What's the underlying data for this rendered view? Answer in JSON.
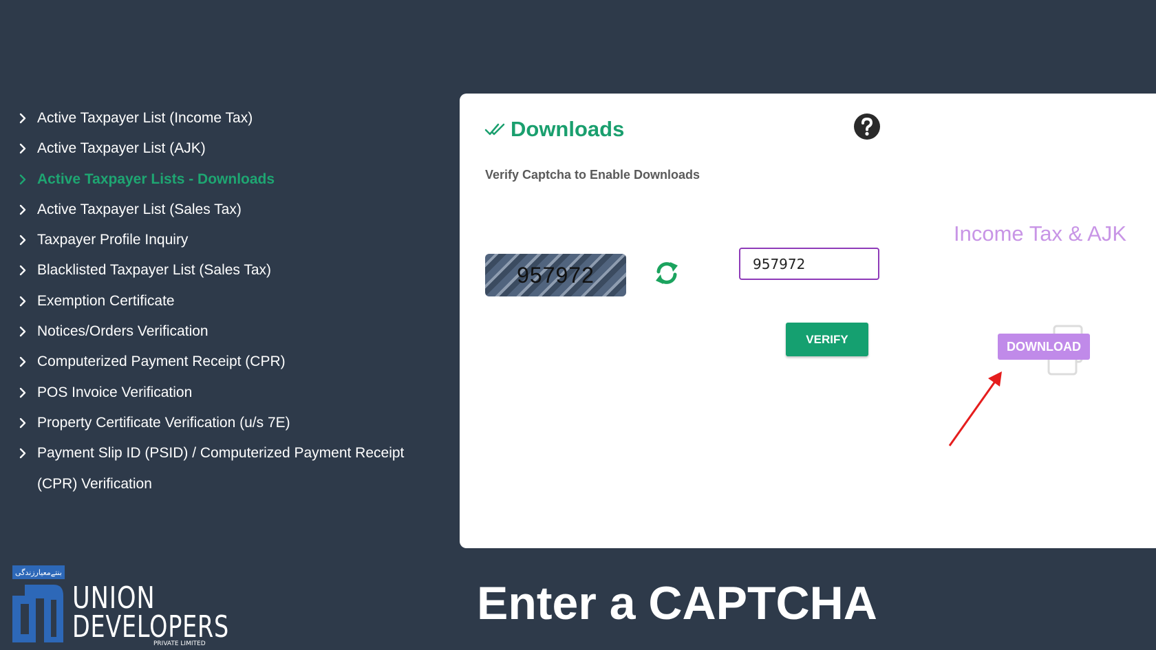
{
  "sidebar": {
    "items": [
      {
        "label": "Active Taxpayer List (Income Tax)",
        "active": false
      },
      {
        "label": "Active Taxpayer List (AJK)",
        "active": false
      },
      {
        "label": "Active Taxpayer Lists - Downloads",
        "active": true
      },
      {
        "label": "Active Taxpayer List (Sales Tax)",
        "active": false
      },
      {
        "label": "Taxpayer Profile Inquiry",
        "active": false
      },
      {
        "label": "Blacklisted Taxpayer List (Sales Tax)",
        "active": false
      },
      {
        "label": "Exemption Certificate",
        "active": false
      },
      {
        "label": "Notices/Orders Verification",
        "active": false
      },
      {
        "label": "Computerized Payment Receipt (CPR)",
        "active": false
      },
      {
        "label": "POS Invoice Verification",
        "active": false
      },
      {
        "label": "Property Certificate Verification (u/s 7E)",
        "active": false
      },
      {
        "label": "Payment Slip ID (PSID) / Computerized Payment Receipt",
        "active": false
      },
      {
        "label": "(CPR) Verification",
        "active": false,
        "continuation": true
      }
    ]
  },
  "panel": {
    "title": "Downloads",
    "subtitle": "Verify Captcha to Enable Downloads",
    "captcha_text": "957972",
    "captcha_input_value": "957972",
    "verify_label": "VERIFY",
    "section_title": "Income Tax & AJK",
    "download_label": "DOWNLOAD"
  },
  "logo": {
    "tagline": "بنتےمعیارزندگی",
    "word1": "UNION",
    "word2": "DEVELOPERS",
    "subtitle": "PRIVATE LIMITED"
  },
  "caption": "Enter a CAPTCHA",
  "colors": {
    "background": "#2e3a4a",
    "accent_green": "#1a9f6e",
    "accent_purple": "#c08ae9",
    "input_border": "#8e3ab8",
    "arrow_red": "#e51d1d"
  },
  "icons": [
    "chevron-right-icon",
    "double-check-icon",
    "help-icon",
    "refresh-icon",
    "file-copy-icon",
    "red-arrow"
  ]
}
